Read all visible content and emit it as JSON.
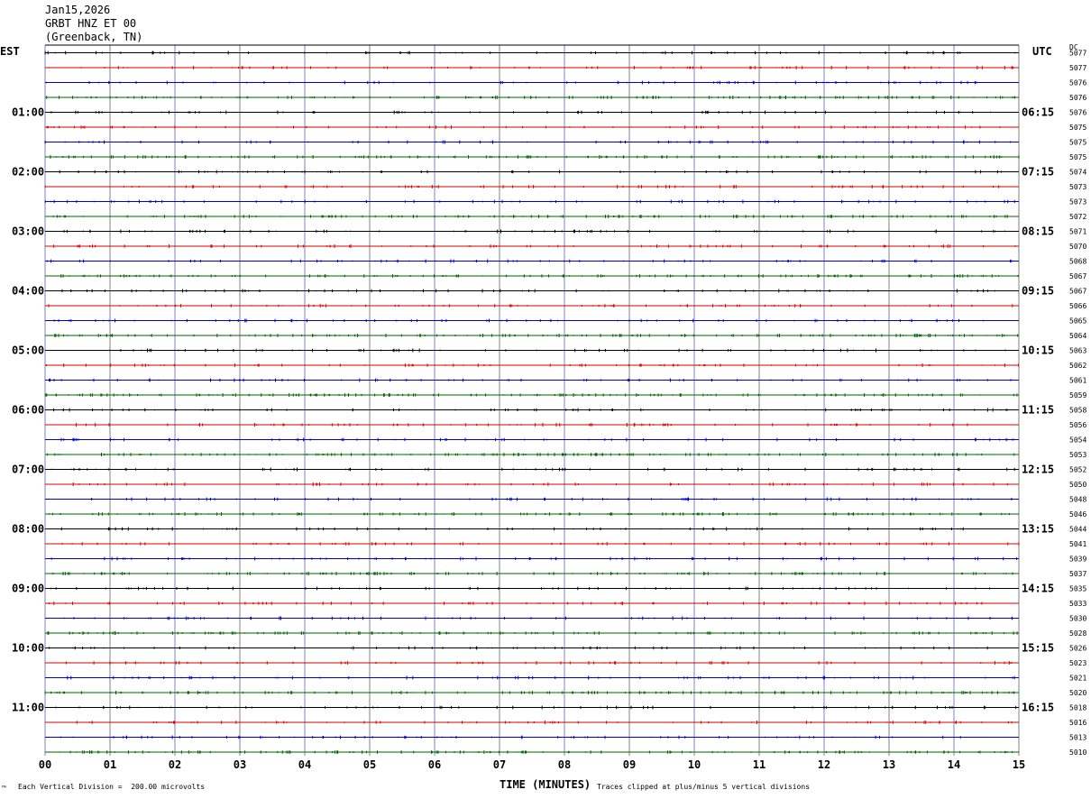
{
  "header": {
    "date": "Jan15,2026",
    "station": "GRBT HNZ ET 00",
    "location": "(Greenback, TN)"
  },
  "left_axis_title": "EST",
  "right_axis_title": "UTC",
  "dc_label": "DC",
  "footer": {
    "scale_note": "Each Vertical Division =  200.00 microvolts",
    "clip_note": "Traces clipped at plus/minus 5 vertical divisions",
    "corner_mark": "™"
  },
  "colors": {
    "trace_cycle": [
      "#000000",
      "#d40000",
      "#0000c8",
      "#006400"
    ],
    "vgrid": [
      "#8080c0",
      "#808080"
    ]
  },
  "chart_data": {
    "type": "line",
    "xlabel": "TIME (MINUTES)",
    "xlim": [
      0,
      15
    ],
    "x_ticks": [
      "00",
      "01",
      "02",
      "03",
      "04",
      "05",
      "06",
      "07",
      "08",
      "09",
      "10",
      "11",
      "12",
      "13",
      "14",
      "15"
    ],
    "left_time_labels": [
      "01:00",
      "02:00",
      "03:00",
      "04:00",
      "05:00",
      "06:00",
      "07:00",
      "08:00",
      "09:00",
      "10:00",
      "11:00"
    ],
    "right_time_labels": [
      "06:15",
      "07:15",
      "08:15",
      "09:15",
      "10:15",
      "11:15",
      "12:15",
      "13:15",
      "14:15",
      "15:15",
      "16:15"
    ],
    "label_every_rows": 4,
    "first_label_row": 4,
    "row_dc_values": [
      "5077",
      "5077",
      "5076",
      "5076",
      "5076",
      "5075",
      "5075",
      "5075",
      "5074",
      "5073",
      "5073",
      "5072",
      "5071",
      "5070",
      "5068",
      "5067",
      "5067",
      "5066",
      "5065",
      "5064",
      "5063",
      "5062",
      "5061",
      "5059",
      "5058",
      "5056",
      "5054",
      "5053",
      "5052",
      "5050",
      "5048",
      "5046",
      "5044",
      "5041",
      "5039",
      "5037",
      "5035",
      "5033",
      "5030",
      "5028",
      "5026",
      "5023",
      "5021",
      "5020",
      "5018",
      "5016",
      "5013",
      "5010"
    ]
  }
}
